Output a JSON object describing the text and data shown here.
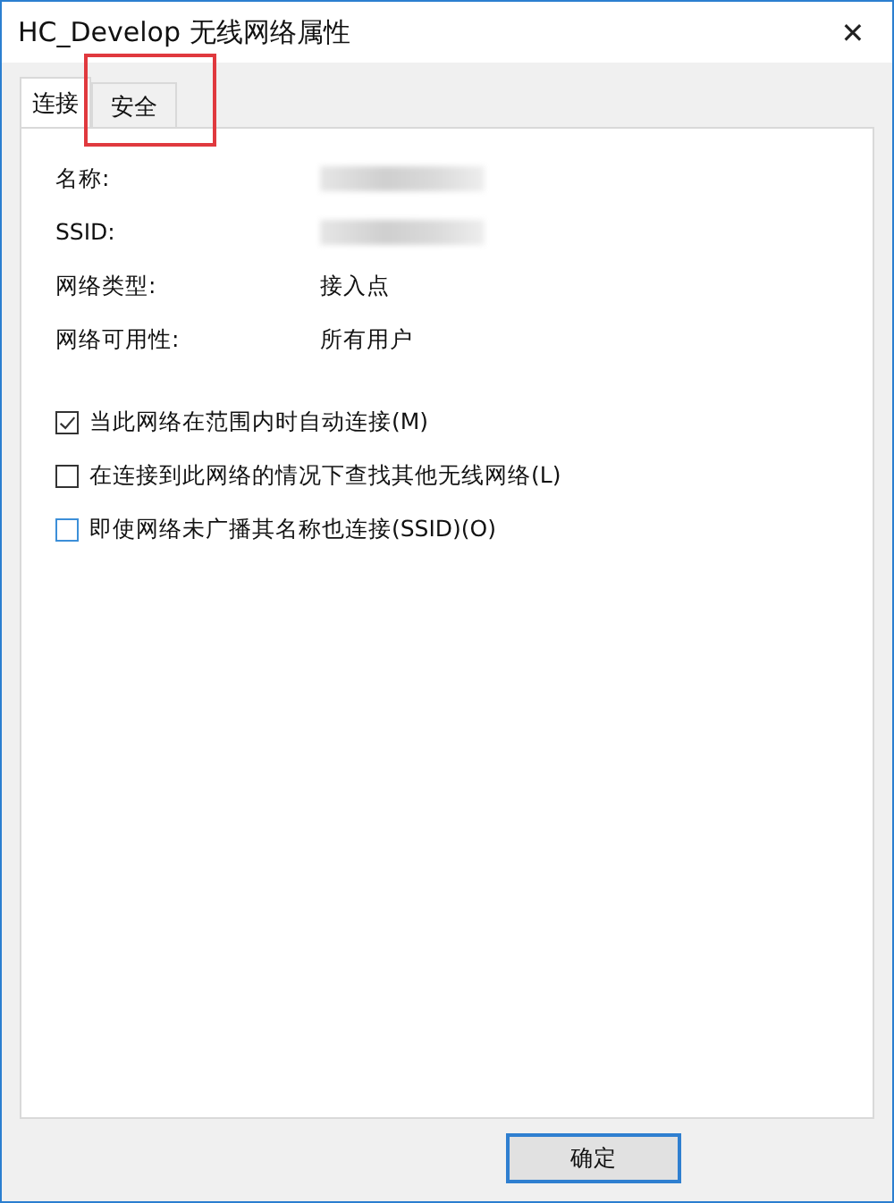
{
  "window": {
    "title": "HC_Develop 无线网络属性",
    "close": "✕"
  },
  "tabs": [
    {
      "label": "连接",
      "selected": true,
      "annotated": false
    },
    {
      "label": "安全",
      "selected": false,
      "annotated": true
    }
  ],
  "properties": [
    {
      "label": "名称:",
      "kind": "blurred"
    },
    {
      "label": "SSID:",
      "kind": "blurred"
    },
    {
      "label": "网络类型:",
      "value": "接入点",
      "kind": "text"
    },
    {
      "label": "网络可用性:",
      "value": "所有用户",
      "kind": "text"
    }
  ],
  "options": [
    {
      "label": "当此网络在范围内时自动连接(M)",
      "checked": true,
      "hovered": false
    },
    {
      "label": "在连接到此网络的情况下查找其他无线网络(L)",
      "checked": false,
      "hovered": false
    },
    {
      "label": "即使网络未广播其名称也连接(SSID)(O)",
      "checked": false,
      "hovered": true
    }
  ],
  "buttons": [
    {
      "label": "确定",
      "default": true
    }
  ]
}
